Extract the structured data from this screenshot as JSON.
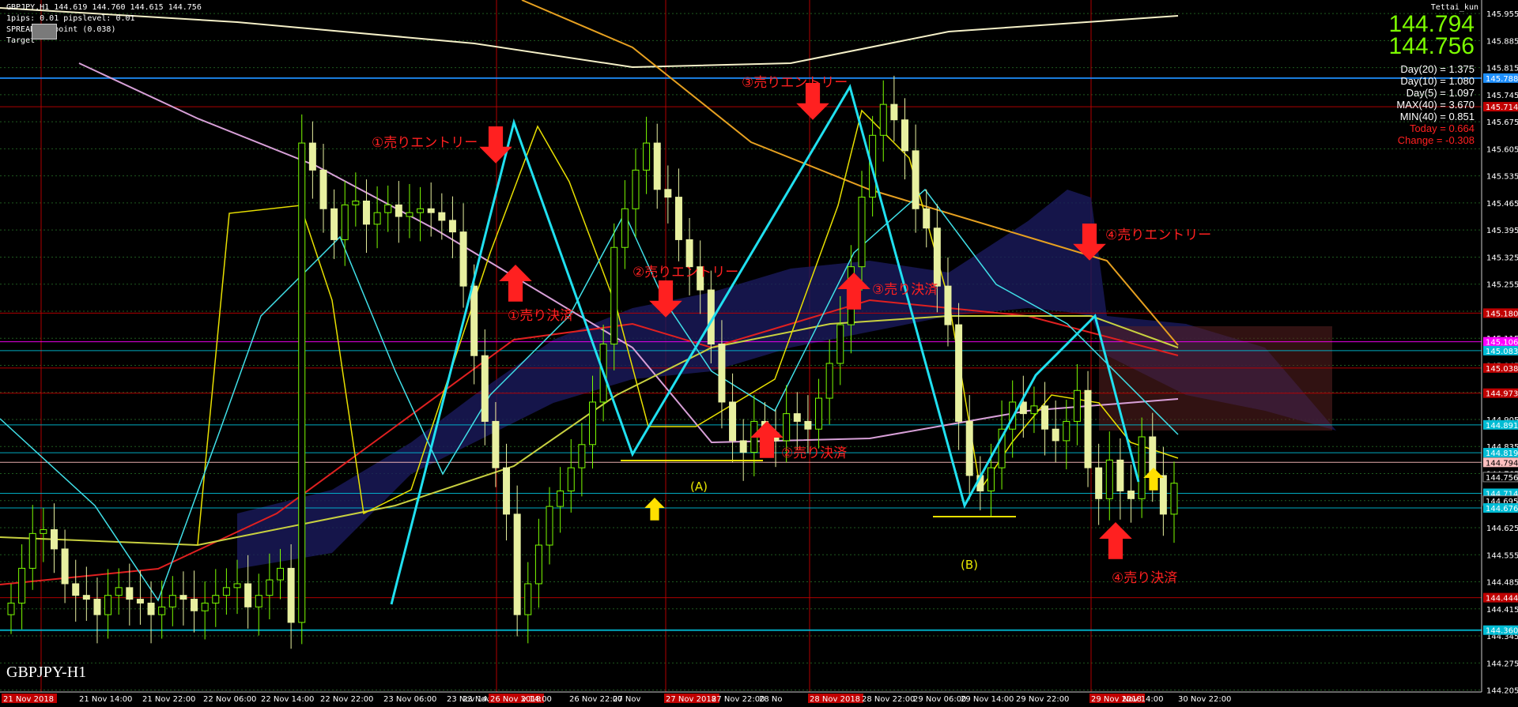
{
  "header": {
    "title_line": "GBPJPY,H1  144.619 144.760 144.615 144.756",
    "line2": "1pips: 0.01  pipslevel: 0.01",
    "line3": "SPREAD: 0 point (0.038)",
    "line4": "Target",
    "author": "Tettai_kun"
  },
  "symbol_label": "GBPJPY-H1",
  "stats": {
    "bid": "144.794",
    "ask": "144.756",
    "day20": "Day(20) = 1.375",
    "day10": "Day(10) = 1.080",
    "day5": "Day(5) = 1.097",
    "max40": "MAX(40) = 3.670",
    "min40": "MIN(40) = 0.851",
    "today": "Today = 0.664",
    "change": "Change = -0.308"
  },
  "annotations": {
    "entry1": "①売りエントリー",
    "exit1": "①売り決済",
    "entry2": "②売りエントリー",
    "exit2": "②売り決済",
    "entry3": "③売りエントリー",
    "exit3": "③売り決済",
    "entry4": "④売りエントリー",
    "exit4": "④売り決済",
    "point_a": "(A)",
    "point_b": "(B)"
  },
  "colors": {
    "background": "#000000",
    "bull_candle": "#7CFC00",
    "bear_candle": "#e8f0a0",
    "annotation": "#ff2020",
    "level_cyan": "#00bfff",
    "level_red": "#c00000",
    "level_magenta": "#ff00ff"
  },
  "chart_data": {
    "type": "line",
    "symbol": "GBPJPY",
    "timeframe": "H1",
    "y_axis_ticks": [
      "145.955",
      "145.885",
      "145.815",
      "145.745",
      "145.675",
      "145.605",
      "145.535",
      "145.465",
      "145.395",
      "145.325",
      "145.255",
      "145.185",
      "145.115",
      "145.045",
      "144.975",
      "144.905",
      "144.835",
      "144.765",
      "144.695",
      "144.625",
      "144.555",
      "144.485",
      "144.415",
      "144.345",
      "144.275",
      "144.205"
    ],
    "ylim": [
      144.2,
      145.99
    ],
    "x_axis_ticks": [
      "21 Nov 2018",
      "21 Nov 14:00",
      "21 Nov 22:00",
      "22 Nov 06:00",
      "22 Nov 14:00",
      "22 Nov 22:00",
      "23 Nov 06:00",
      "23 Nov 14:00",
      "23 Nov 22:00",
      "26 Nov 2018",
      "v 14:00",
      "26 Nov 22:00",
      "27 Nov",
      "27 Nov 2018",
      "27 Nov 22:00",
      "28 No",
      "28 Nov 2018",
      "28 Nov 22:00",
      "29 Nov 06:00",
      "29 Nov 14:00",
      "29 Nov 22:00",
      "29 Nov 2018",
      "Nov 14:00",
      "30 Nov 22:00"
    ],
    "price_tags": [
      {
        "label": "145.788",
        "color": "#1e90ff",
        "price": 145.788
      },
      {
        "label": "145.714",
        "color": "#c00000",
        "price": 145.714
      },
      {
        "label": "145.180",
        "color": "#c00000",
        "price": 145.18
      },
      {
        "label": "145.106",
        "color": "#ff00ff",
        "price": 145.106
      },
      {
        "label": "145.083",
        "color": "#00bcd4",
        "price": 145.083
      },
      {
        "label": "145.038",
        "color": "#c00000",
        "price": 145.038
      },
      {
        "label": "144.973",
        "color": "#c00000",
        "price": 144.973
      },
      {
        "label": "144.891",
        "color": "#00bcd4",
        "price": 144.891
      },
      {
        "label": "144.819",
        "color": "#00bcd4",
        "price": 144.819
      },
      {
        "label": "144.794",
        "color": "#ffc0c0",
        "price": 144.794
      },
      {
        "label": "144.756",
        "color": "#000000",
        "price": 144.756
      },
      {
        "label": "144.714",
        "color": "#00bcd4",
        "price": 144.714
      },
      {
        "label": "144.695",
        "color": "#000000",
        "price": 144.695
      },
      {
        "label": "144.676",
        "color": "#00bcd4",
        "price": 144.676
      },
      {
        "label": "144.444",
        "color": "#c00000",
        "price": 144.444
      },
      {
        "label": "144.360",
        "color": "#00bcd4",
        "price": 144.36
      }
    ],
    "series": [
      {
        "name": "close",
        "values": [
          144.43,
          144.52,
          144.61,
          144.62,
          144.57,
          144.48,
          144.45,
          144.44,
          144.4,
          144.45,
          144.47,
          144.44,
          144.43,
          144.4,
          144.42,
          144.45,
          144.44,
          144.41,
          144.43,
          144.45,
          144.47,
          144.48,
          144.42,
          144.45,
          144.49,
          144.52,
          144.38,
          145.62,
          145.55,
          145.45,
          145.37,
          145.46,
          145.47,
          145.41,
          145.44,
          145.46,
          145.43,
          145.44,
          145.45,
          145.44,
          145.42,
          145.39,
          145.25,
          145.07,
          144.9,
          144.78,
          144.66,
          144.4,
          144.48,
          144.58,
          144.68,
          144.72,
          144.78,
          144.84,
          144.95,
          145.1,
          145.35,
          145.45,
          145.55,
          145.62,
          145.5,
          145.48,
          145.37,
          145.3,
          145.24,
          145.1,
          144.95,
          144.85,
          144.82,
          144.9,
          144.87,
          144.85,
          144.92,
          144.9,
          144.88,
          144.96,
          145.05,
          145.15,
          145.3,
          145.48,
          145.64,
          145.72,
          145.68,
          145.6,
          145.45,
          145.4,
          145.25,
          145.15,
          144.9,
          144.76,
          144.72,
          144.78,
          144.88,
          144.95,
          144.92,
          144.94,
          144.88,
          144.85,
          144.9,
          144.98,
          144.78,
          144.7,
          144.8,
          144.72,
          144.7,
          144.86,
          144.76,
          144.66,
          144.74
        ]
      }
    ]
  }
}
